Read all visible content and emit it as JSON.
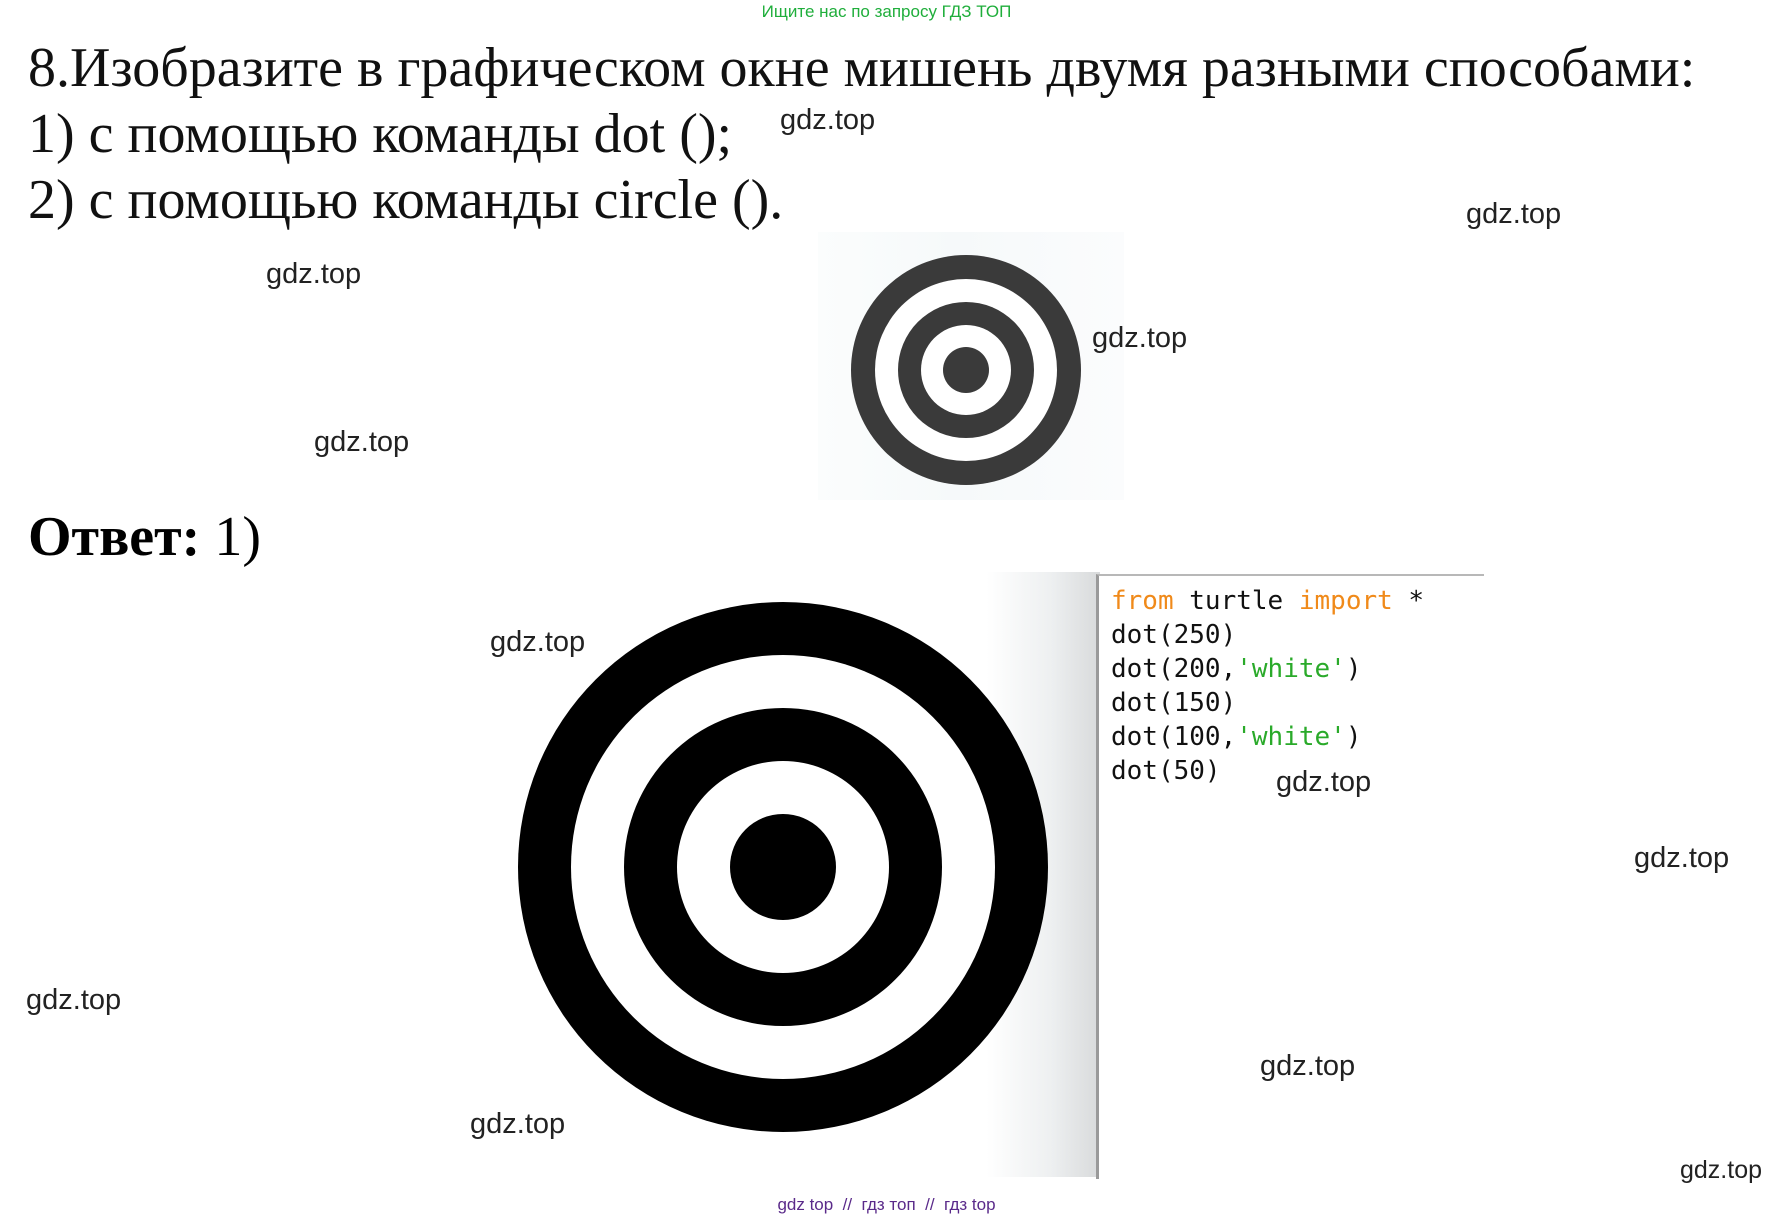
{
  "banner": "Ищите нас по запросу ГДЗ ТОП",
  "task": {
    "line1": "8.Изобразите в графическом окне мишень двумя разными способами:",
    "line2": "1) с помощью команды dot ();",
    "line3": "2) с помощью команды circle ()."
  },
  "answer": {
    "label": "Ответ:",
    "item": "1)"
  },
  "code": {
    "line1_kw1": "from",
    "line1_mid": " turtle ",
    "line1_kw2": "import",
    "line1_end": " *",
    "line2": "dot(250)",
    "line3_pre": "dot(200,",
    "line3_str": "'white'",
    "line3_post": ")",
    "line4": "dot(150)",
    "line5_pre": "dot(100,",
    "line5_str": "'white'",
    "line5_post": ")",
    "line6": "dot(50)"
  },
  "watermark": "gdz.top",
  "footer": "gdz top  //  гдз топ  //  гдз top",
  "colors": {
    "banner": "#1fae3b",
    "keyword": "#f08a1a",
    "string": "#2aaa2a",
    "footer": "#5a2a8a",
    "target": "#000000",
    "book_target": "#3a3a3a"
  }
}
